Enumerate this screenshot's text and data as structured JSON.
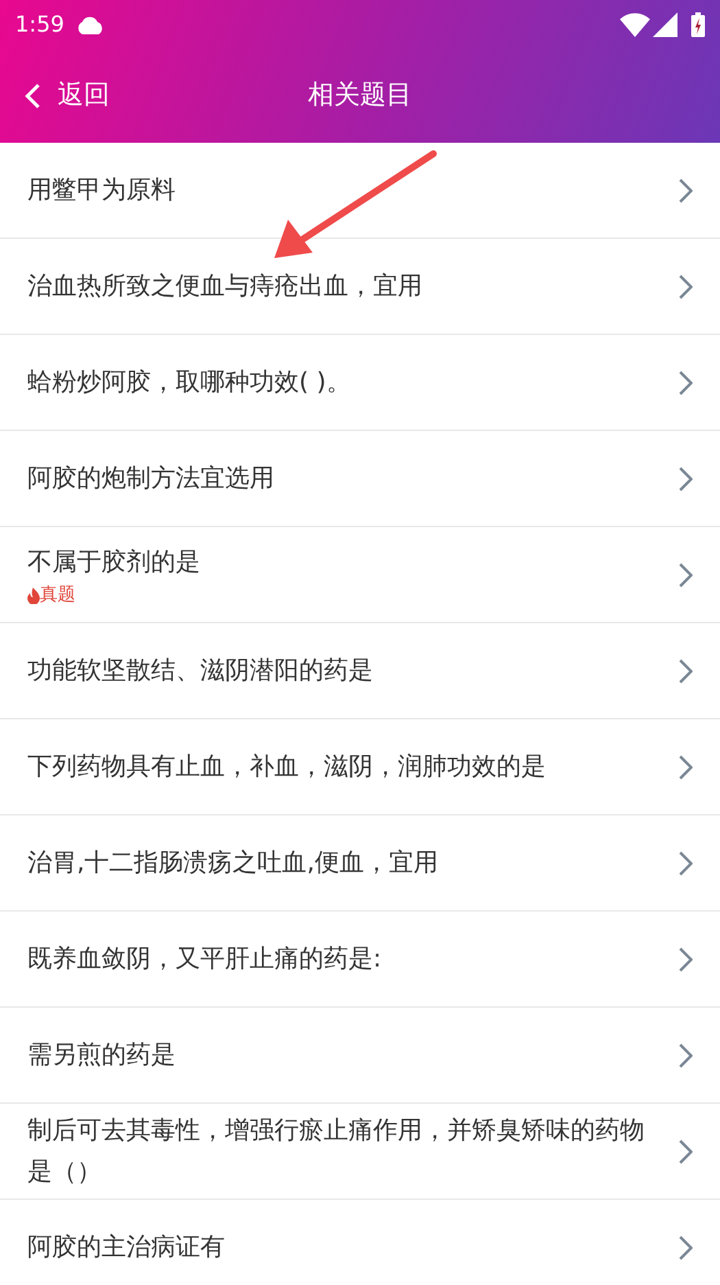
{
  "status_bar": {
    "time": "1:59"
  },
  "header": {
    "back": "返回",
    "title": "相关题目"
  },
  "questions": [
    {
      "text": "用鳖甲为原料"
    },
    {
      "text": "治血热所致之便血与痔疮出血，宜用"
    },
    {
      "text": "蛤粉炒阿胶，取哪种功效( )。"
    },
    {
      "text": "阿胶的炮制方法宜选用"
    },
    {
      "text": "不属于胶剂的是",
      "tag": "真题"
    },
    {
      "text": "功能软坚散结、滋阴潜阳的药是"
    },
    {
      "text": "下列药物具有止血，补血，滋阴，润肺功效的是"
    },
    {
      "text": "治胃,十二指肠溃疡之吐血,便血，宜用"
    },
    {
      "text": "既养血敛阴，又平肝止痛的药是:"
    },
    {
      "text": "需另煎的药是"
    },
    {
      "text": "制后可去其毒性，增强行瘀止痛作用，并矫臭矫味的药物是（）"
    },
    {
      "text": "阿胶的主治病证有"
    }
  ]
}
